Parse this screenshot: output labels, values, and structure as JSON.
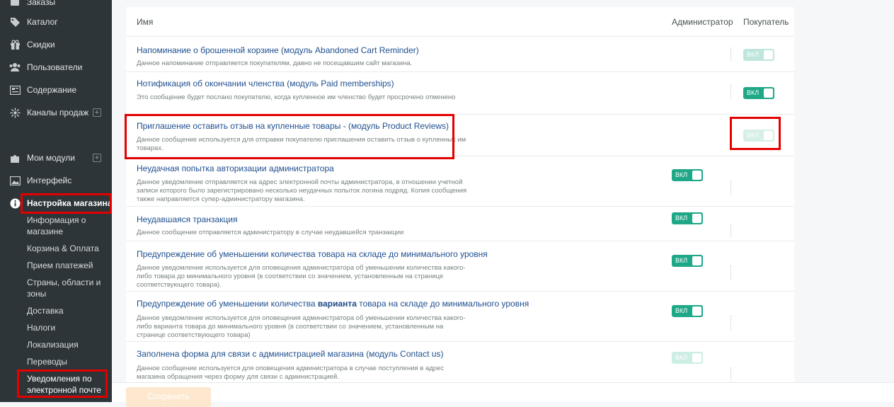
{
  "sidebar": {
    "items": [
      {
        "label": "Заказы",
        "icon": "orders-icon"
      },
      {
        "label": "Каталог",
        "icon": "tag-icon"
      },
      {
        "label": "Скидки",
        "icon": "gift-icon"
      },
      {
        "label": "Пользователи",
        "icon": "users-icon"
      },
      {
        "label": "Содержание",
        "icon": "content-icon"
      },
      {
        "label": "Каналы продаж",
        "icon": "sales-channels-icon"
      },
      {
        "label": "Мои модули",
        "icon": "puzzle-icon"
      },
      {
        "label": "Интерфейс",
        "icon": "image-icon"
      },
      {
        "label": "Настройка магазина",
        "icon": "info-icon"
      }
    ],
    "subitems": [
      "Информация о магазине",
      "Корзина & Оплата",
      "Прием платежей",
      "Страны, области и зоны",
      "Доставка",
      "Налоги",
      "Локализация",
      "Переводы",
      "Уведомления по электронной почте"
    ]
  },
  "table": {
    "headers": {
      "name": "Имя",
      "admin": "Администратор",
      "customer": "Покупатель"
    },
    "toggle_label": "ВКЛ",
    "rows": [
      {
        "title": "Напоминание о брошенной корзине (модуль Abandoned Cart Reminder)",
        "desc": "Данное напоминание отправляется покупателям, давно не посещавшим сайт магазина."
      },
      {
        "title": "Нотификация об окончании членства (модуль Paid memberships)",
        "desc": "Это сообщение будет послано покупателю, когда купленное им членство будет просрочено отменено"
      },
      {
        "title": "Приглашение оставить отзыв на купленные товары - (модуль Product Reviews)",
        "desc": "Данное сообщение используется для отправки покупателю приглашения оставить отзыв о купленных им товарах."
      },
      {
        "title": "Неудачная попытка авторизации администратора",
        "desc": "Данное уведомление отправляется на адрес электронной почты администратора, в отношении учетной записи которого было зарегистрировано несколько неудачных попыток логина подряд. Копия сообщения также направляется супер-администратору магазина."
      },
      {
        "title": "Неудавшаяся транзакция",
        "desc": "Данное сообщение отправляется администратору в случае неудавшейся транзакции"
      },
      {
        "title": "Предупреждение об уменьшении количества товара на складе до минимального уровня",
        "desc": "Данное уведомление используется для оповещения администратора об уменьшении количества какого-либо товара до минимального уровня (в соответствии со значением, установленным на странице соответствующего товара)."
      },
      {
        "title_pre": "Предупреждение об уменьшении количества ",
        "title_bold": "варианта",
        "title_post": " товара на складе до минимального уровня",
        "desc": "Данное уведомление используется для оповещения администратора об уменьшении количества какого-либо варианта товара до минимального уровня (в соответствии со значением, установленным на странице соответствующего товара)"
      },
      {
        "title": "Заполнена форма для связи с администрацией магазина (модуль Contact us)",
        "desc": "Данное сообщение используется для оповещения администратора в случае поступления в адрес магазина обращения через форму для связи с администрацией."
      }
    ]
  },
  "save_label": "Сохранить",
  "colors": {
    "accent": "#1ea888",
    "link": "#1f4f8f",
    "highlight": "#e50000",
    "sidebar": "#2d3538"
  }
}
